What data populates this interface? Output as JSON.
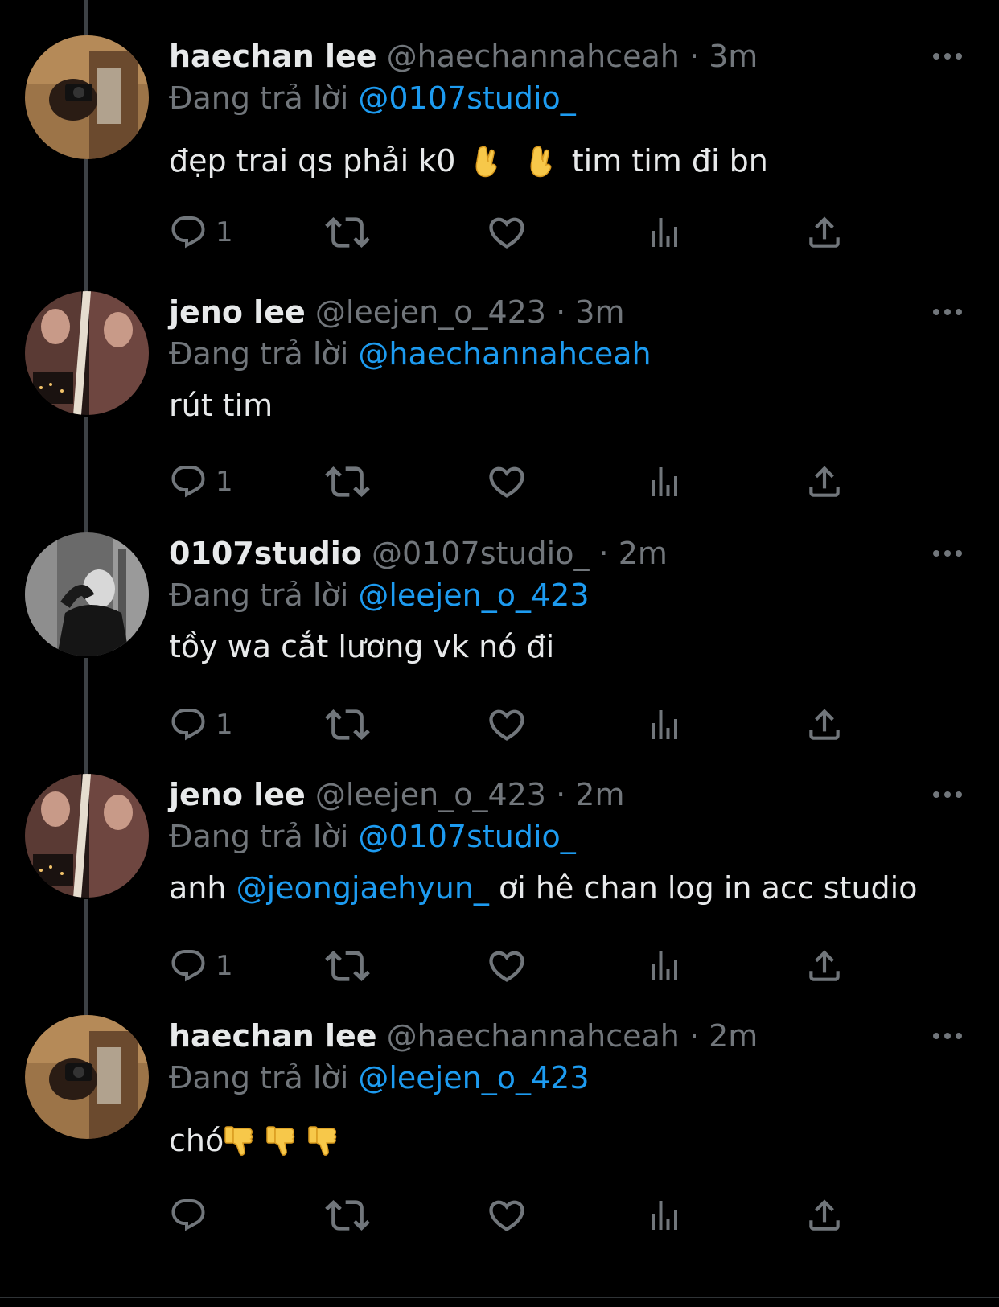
{
  "colors": {
    "background": "#000000",
    "primary_text": "#e7e9ea",
    "secondary_text": "#71767b",
    "link": "#1d9bf0",
    "thread_line": "#3d4145"
  },
  "tweets": [
    {
      "display_name": "haechan lee",
      "handle": "@haechannahceah",
      "separator": "·",
      "time": "3m",
      "reply_prefix": "Đang trả lời",
      "reply_to": "@0107studio_",
      "text_before": "đẹp trai qs phải k0",
      "emoji": [
        "crossed-fingers-emoji",
        "crossed-fingers-emoji"
      ],
      "text_after": "tim tim đi bn",
      "reply_count": "1",
      "avatar": "avatar-photo-icon"
    },
    {
      "display_name": "jeno lee",
      "handle": "@leejen_o_423",
      "separator": "·",
      "time": "3m",
      "reply_prefix": "Đang trả lời",
      "reply_to": "@haechannahceah",
      "text": "rút tim",
      "reply_count": "1",
      "avatar": "avatar-photo-icon"
    },
    {
      "display_name": "0107studio",
      "handle": "@0107studio_",
      "separator": "·",
      "time": "2m",
      "reply_prefix": "Đang trả lời",
      "reply_to": "@leejen_o_423",
      "text": "tồy wa cắt lương vk nó đi",
      "reply_count": "1",
      "avatar": "avatar-photo-icon"
    },
    {
      "display_name": "jeno lee",
      "handle": "@leejen_o_423",
      "separator": "·",
      "time": "2m",
      "reply_prefix": "Đang trả lời",
      "reply_to": "@0107studio_",
      "text_before": "anh",
      "text_mention": "@jeongjaehyun_",
      "text_after": "ơi hê chan log in acc studio",
      "reply_count": "1",
      "avatar": "avatar-photo-icon"
    },
    {
      "display_name": "haechan lee",
      "handle": "@haechannahceah",
      "separator": "·",
      "time": "2m",
      "reply_prefix": "Đang trả lời",
      "reply_to": "@leejen_o_423",
      "text": "chó",
      "emoji": [
        "thumbs-down-emoji",
        "thumbs-down-emoji",
        "thumbs-down-emoji"
      ],
      "reply_count": "",
      "avatar": "avatar-photo-icon"
    }
  ]
}
